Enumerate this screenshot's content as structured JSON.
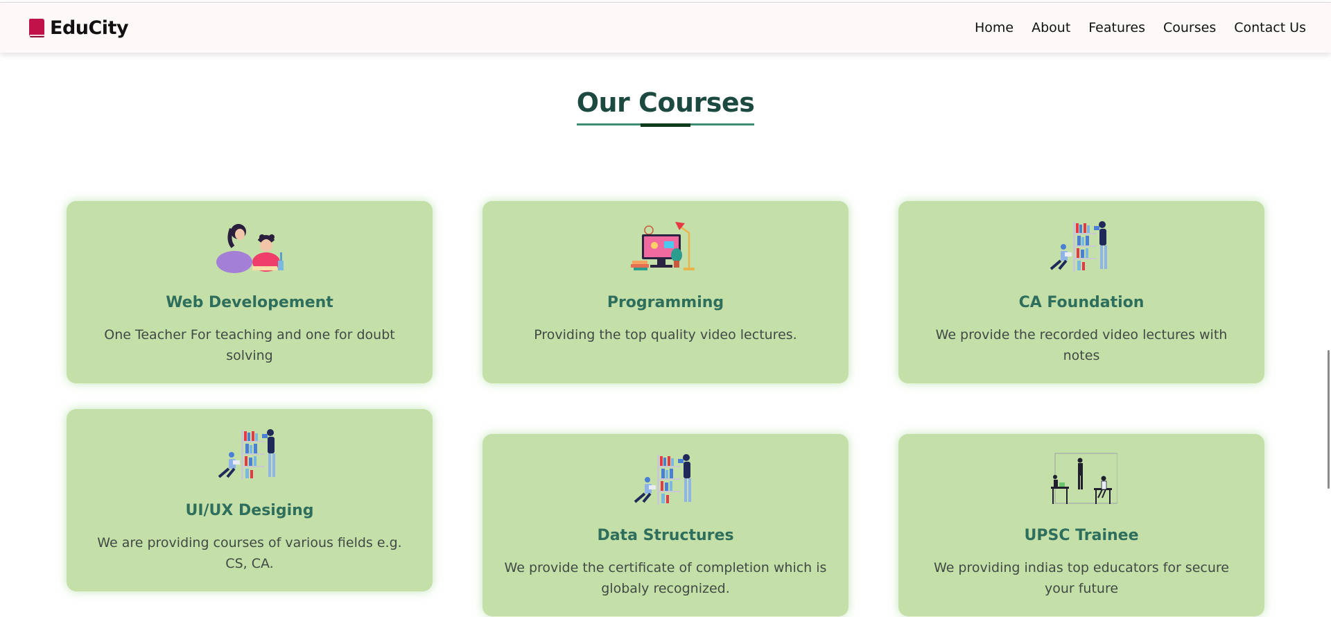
{
  "brand": {
    "name": "EduCity",
    "icon": "book-icon"
  },
  "nav": {
    "items": [
      "Home",
      "About",
      "Features",
      "Courses",
      "Contact Us"
    ]
  },
  "section": {
    "title": "Our Courses"
  },
  "courses": [
    {
      "title": "Web Developement",
      "description": "One Teacher For teaching and one for doubt solving",
      "illustration": "teacher-student-illustration"
    },
    {
      "title": "Programming",
      "description": "Providing the top quality video lectures.",
      "illustration": "monitor-lamp-illustration"
    },
    {
      "title": "CA Foundation",
      "description": "We provide the recorded video lectures with notes",
      "illustration": "bookshelf-readers-illustration"
    },
    {
      "title": "UI/UX Desiging",
      "description": "We are providing courses of various fields e.g. CS, CA.",
      "illustration": "bookshelf-readers-illustration"
    },
    {
      "title": "Data Structures",
      "description": "We provide the certificate of completion which is globaly recognized.",
      "illustration": "bookshelf-readers-illustration"
    },
    {
      "title": "UPSC Trainee",
      "description": "We providing indias top educators for secure your future",
      "illustration": "classroom-illustration"
    }
  ],
  "colors": {
    "card_bg": "#c5dfa9",
    "title": "#1d4a40",
    "card_title": "#2e6e5c",
    "brand_icon": "#c1124a"
  }
}
